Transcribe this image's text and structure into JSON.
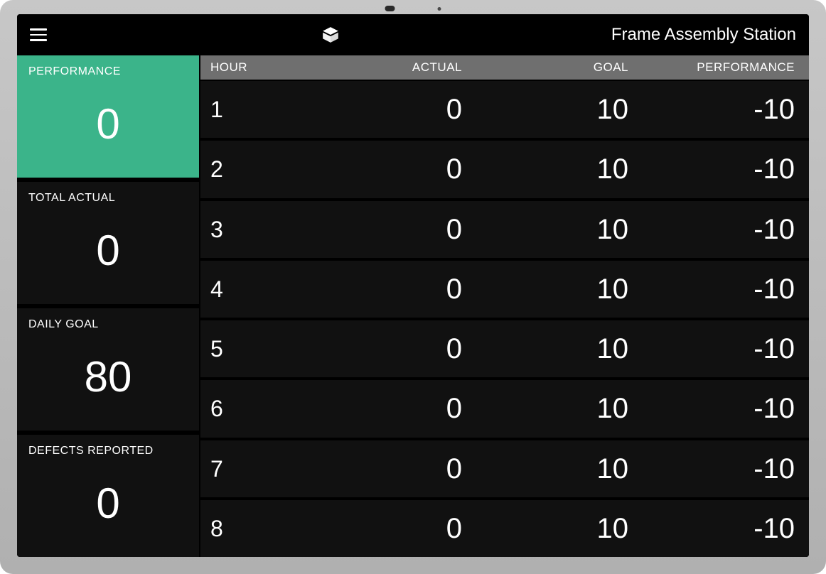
{
  "header": {
    "station_title": "Frame Assembly Station"
  },
  "sidebar": {
    "performance": {
      "label": "PERFORMANCE",
      "value": "0"
    },
    "total_actual": {
      "label": "TOTAL ACTUAL",
      "value": "0"
    },
    "daily_goal": {
      "label": "DAILY GOAL",
      "value": "80"
    },
    "defects_reported": {
      "label": "DEFECTS REPORTED",
      "value": "0"
    }
  },
  "table": {
    "columns": {
      "hour": "HOUR",
      "actual": "ACTUAL",
      "goal": "GOAL",
      "performance": "PERFORMANCE"
    },
    "rows": [
      {
        "hour": "1",
        "actual": "0",
        "goal": "10",
        "performance": "-10"
      },
      {
        "hour": "2",
        "actual": "0",
        "goal": "10",
        "performance": "-10"
      },
      {
        "hour": "3",
        "actual": "0",
        "goal": "10",
        "performance": "-10"
      },
      {
        "hour": "4",
        "actual": "0",
        "goal": "10",
        "performance": "-10"
      },
      {
        "hour": "5",
        "actual": "0",
        "goal": "10",
        "performance": "-10"
      },
      {
        "hour": "6",
        "actual": "0",
        "goal": "10",
        "performance": "-10"
      },
      {
        "hour": "7",
        "actual": "0",
        "goal": "10",
        "performance": "-10"
      },
      {
        "hour": "8",
        "actual": "0",
        "goal": "10",
        "performance": "-10"
      }
    ]
  },
  "colors": {
    "accent_green": "#3bb48a",
    "panel_bg": "#111111",
    "header_row_bg": "#6f6f6f"
  }
}
